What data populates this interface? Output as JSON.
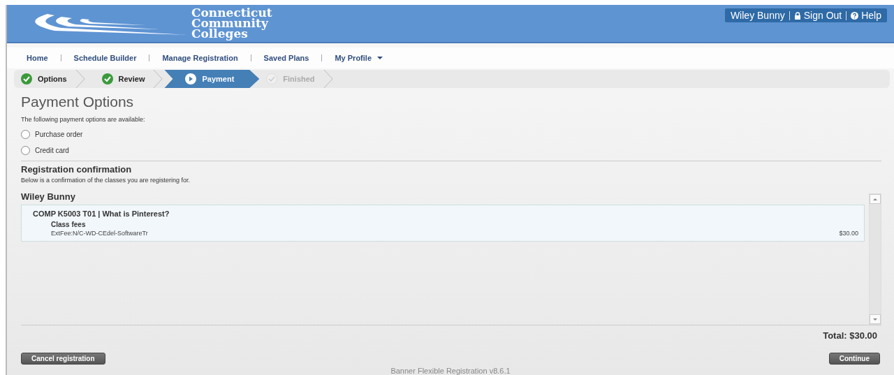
{
  "header": {
    "logo_lines": [
      "Connecticut",
      "Community",
      "Colleges"
    ],
    "user": "Wiley Bunny",
    "sign_out": "Sign Out",
    "help": "Help"
  },
  "nav": [
    {
      "label": "Home",
      "dropdown": false
    },
    {
      "label": "Schedule Builder",
      "dropdown": false
    },
    {
      "label": "Manage Registration",
      "dropdown": false
    },
    {
      "label": "Saved Plans",
      "dropdown": false
    },
    {
      "label": "My Profile",
      "dropdown": true
    }
  ],
  "steps": [
    {
      "label": "Options",
      "completed": true,
      "selected": false
    },
    {
      "label": "Review",
      "completed": true,
      "selected": false
    },
    {
      "label": "Payment",
      "completed": false,
      "selected": true
    },
    {
      "label": "Finished",
      "completed": false,
      "selected": false
    }
  ],
  "title": "Payment Options",
  "intro": "The following payment options are available:",
  "payment_options": [
    {
      "label": "Purchase order",
      "selected": false
    },
    {
      "label": "Credit card",
      "selected": false
    }
  ],
  "confirmation": {
    "heading": "Registration confirmation",
    "text": "Below is a confirmation of the classes you are registering for.",
    "student": "Wiley Bunny",
    "classes": [
      {
        "title": "COMP K5003 T01 | What is Pinterest?",
        "fee_heading": "Class fees",
        "fees": [
          {
            "name": "ExtFee:N/C-WD-CEdel-SoftwareTr",
            "amount": "$30.00"
          }
        ]
      }
    ]
  },
  "total": "Total: $30.00",
  "cancel_button": "Cancel registration",
  "continue_button": "Continue",
  "footer": "Banner Flexible Registration v8.6.1"
}
